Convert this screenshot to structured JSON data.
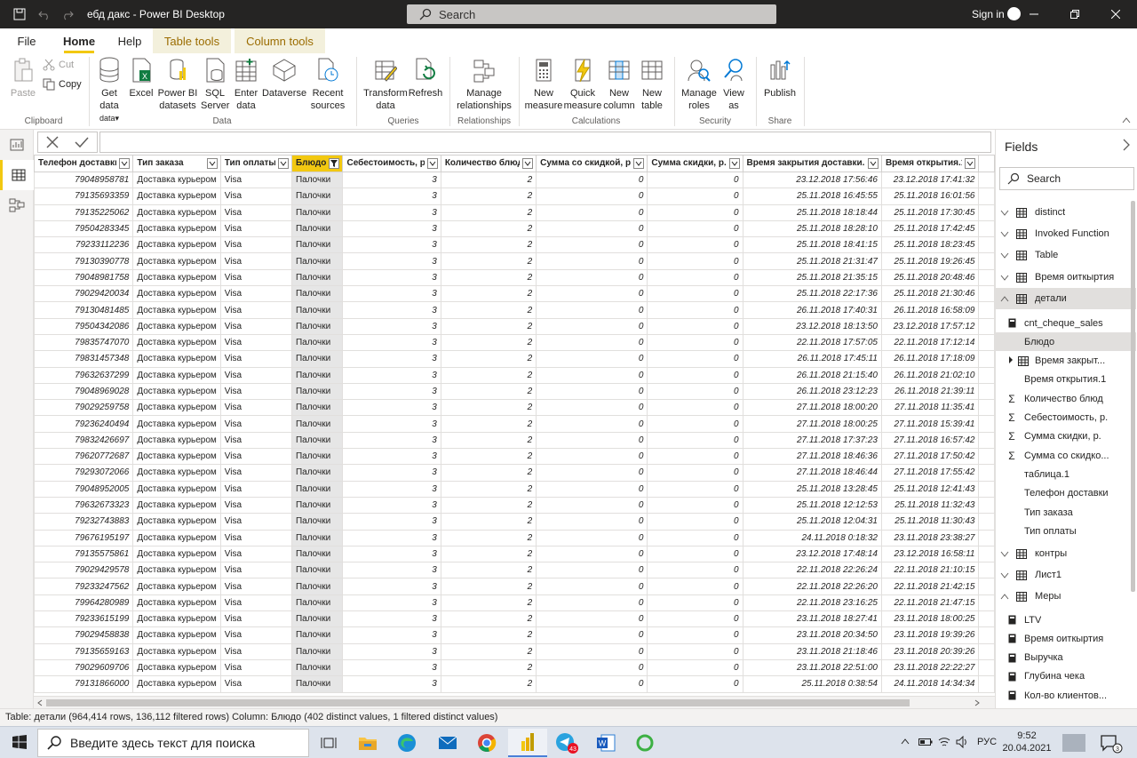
{
  "window": {
    "title": "ебд дакс - Power BI Desktop",
    "search_placeholder": "Search",
    "sign_in": "Sign in"
  },
  "ribbon_tabs": [
    "File",
    "Home",
    "Help",
    "Table tools",
    "Column tools"
  ],
  "ribbon": {
    "clipboard": {
      "paste": "Paste",
      "cut": "Cut",
      "copy": "Copy",
      "group": "Clipboard"
    },
    "data": {
      "get_data": "Get data",
      "excel": "Excel",
      "powerbi_datasets": "Power BI datasets",
      "sql_server": "SQL Server",
      "enter_data": "Enter data",
      "dataverse": "Dataverse",
      "recent_sources": "Recent sources",
      "group": "Data"
    },
    "queries": {
      "transform_data": "Transform data",
      "refresh": "Refresh",
      "group": "Queries"
    },
    "relationships": {
      "manage_relationships": "Manage relationships",
      "group": "Relationships"
    },
    "calculations": {
      "new_measure": "New measure",
      "quick_measure": "Quick measure",
      "new_column": "New column",
      "new_table": "New table",
      "group": "Calculations"
    },
    "security": {
      "manage_roles": "Manage roles",
      "view_as": "View as",
      "group": "Security"
    },
    "share": {
      "publish": "Publish",
      "group": "Share"
    }
  },
  "table": {
    "columns": [
      "Телефон доставки",
      "Тип заказа",
      "Тип оплаты",
      "Блюдо",
      "Себестоимость, р.",
      "Количество блюд",
      "Сумма со скидкой, р.",
      "Сумма скидки, р.",
      "Время закрытия доставки.1",
      "Время открытия.1",
      "та"
    ],
    "rows": [
      [
        "79048958781",
        "Доставка курьером",
        "Visa",
        "Палочки",
        "3",
        "2",
        "0",
        "0",
        "23.12.2018 17:56:46",
        "23.12.2018 17:41:32"
      ],
      [
        "79135693359",
        "Доставка курьером",
        "Visa",
        "Палочки",
        "3",
        "2",
        "0",
        "0",
        "25.11.2018 16:45:55",
        "25.11.2018 16:01:56"
      ],
      [
        "79135225062",
        "Доставка курьером",
        "Visa",
        "Палочки",
        "3",
        "2",
        "0",
        "0",
        "25.11.2018 18:18:44",
        "25.11.2018 17:30:45"
      ],
      [
        "79504283345",
        "Доставка курьером",
        "Visa",
        "Палочки",
        "3",
        "2",
        "0",
        "0",
        "25.11.2018 18:28:10",
        "25.11.2018 17:42:45"
      ],
      [
        "79233112236",
        "Доставка курьером",
        "Visa",
        "Палочки",
        "3",
        "2",
        "0",
        "0",
        "25.11.2018 18:41:15",
        "25.11.2018 18:23:45"
      ],
      [
        "79130390778",
        "Доставка курьером",
        "Visa",
        "Палочки",
        "3",
        "2",
        "0",
        "0",
        "25.11.2018 21:31:47",
        "25.11.2018 19:26:45"
      ],
      [
        "79048981758",
        "Доставка курьером",
        "Visa",
        "Палочки",
        "3",
        "2",
        "0",
        "0",
        "25.11.2018 21:35:15",
        "25.11.2018 20:48:46"
      ],
      [
        "79029420034",
        "Доставка курьером",
        "Visa",
        "Палочки",
        "3",
        "2",
        "0",
        "0",
        "25.11.2018 22:17:36",
        "25.11.2018 21:30:46"
      ],
      [
        "79130481485",
        "Доставка курьером",
        "Visa",
        "Палочки",
        "3",
        "2",
        "0",
        "0",
        "26.11.2018 17:40:31",
        "26.11.2018 16:58:09"
      ],
      [
        "79504342086",
        "Доставка курьером",
        "Visa",
        "Палочки",
        "3",
        "2",
        "0",
        "0",
        "23.12.2018 18:13:50",
        "23.12.2018 17:57:12"
      ],
      [
        "79835747070",
        "Доставка курьером",
        "Visa",
        "Палочки",
        "3",
        "2",
        "0",
        "0",
        "22.11.2018 17:57:05",
        "22.11.2018 17:12:14"
      ],
      [
        "79831457348",
        "Доставка курьером",
        "Visa",
        "Палочки",
        "3",
        "2",
        "0",
        "0",
        "26.11.2018 17:45:11",
        "26.11.2018 17:18:09"
      ],
      [
        "79632637299",
        "Доставка курьером",
        "Visa",
        "Палочки",
        "3",
        "2",
        "0",
        "0",
        "26.11.2018 21:15:40",
        "26.11.2018 21:02:10"
      ],
      [
        "79048969028",
        "Доставка курьером",
        "Visa",
        "Палочки",
        "3",
        "2",
        "0",
        "0",
        "26.11.2018 23:12:23",
        "26.11.2018 21:39:11"
      ],
      [
        "79029259758",
        "Доставка курьером",
        "Visa",
        "Палочки",
        "3",
        "2",
        "0",
        "0",
        "27.11.2018 18:00:20",
        "27.11.2018 11:35:41"
      ],
      [
        "79236240494",
        "Доставка курьером",
        "Visa",
        "Палочки",
        "3",
        "2",
        "0",
        "0",
        "27.11.2018 18:00:25",
        "27.11.2018 15:39:41"
      ],
      [
        "79832426697",
        "Доставка курьером",
        "Visa",
        "Палочки",
        "3",
        "2",
        "0",
        "0",
        "27.11.2018 17:37:23",
        "27.11.2018 16:57:42"
      ],
      [
        "79620772687",
        "Доставка курьером",
        "Visa",
        "Палочки",
        "3",
        "2",
        "0",
        "0",
        "27.11.2018 18:46:36",
        "27.11.2018 17:50:42"
      ],
      [
        "79293072066",
        "Доставка курьером",
        "Visa",
        "Палочки",
        "3",
        "2",
        "0",
        "0",
        "27.11.2018 18:46:44",
        "27.11.2018 17:55:42"
      ],
      [
        "79048952005",
        "Доставка курьером",
        "Visa",
        "Палочки",
        "3",
        "2",
        "0",
        "0",
        "25.11.2018 13:28:45",
        "25.11.2018 12:41:43"
      ],
      [
        "79632673323",
        "Доставка курьером",
        "Visa",
        "Палочки",
        "3",
        "2",
        "0",
        "0",
        "25.11.2018 12:12:53",
        "25.11.2018 11:32:43"
      ],
      [
        "79232743883",
        "Доставка курьером",
        "Visa",
        "Палочки",
        "3",
        "2",
        "0",
        "0",
        "25.11.2018 12:04:31",
        "25.11.2018 11:30:43"
      ],
      [
        "79676195197",
        "Доставка курьером",
        "Visa",
        "Палочки",
        "3",
        "2",
        "0",
        "0",
        "24.11.2018 0:18:32",
        "23.11.2018 23:38:27"
      ],
      [
        "79135575861",
        "Доставка курьером",
        "Visa",
        "Палочки",
        "3",
        "2",
        "0",
        "0",
        "23.12.2018 17:48:14",
        "23.12.2018 16:58:11"
      ],
      [
        "79029429578",
        "Доставка курьером",
        "Visa",
        "Палочки",
        "3",
        "2",
        "0",
        "0",
        "22.11.2018 22:26:24",
        "22.11.2018 21:10:15"
      ],
      [
        "79233247562",
        "Доставка курьером",
        "Visa",
        "Палочки",
        "3",
        "2",
        "0",
        "0",
        "22.11.2018 22:26:20",
        "22.11.2018 21:42:15"
      ],
      [
        "79964280989",
        "Доставка курьером",
        "Visa",
        "Палочки",
        "3",
        "2",
        "0",
        "0",
        "22.11.2018 23:16:25",
        "22.11.2018 21:47:15"
      ],
      [
        "79233615199",
        "Доставка курьером",
        "Visa",
        "Палочки",
        "3",
        "2",
        "0",
        "0",
        "23.11.2018 18:27:41",
        "23.11.2018 18:00:25"
      ],
      [
        "79029458838",
        "Доставка курьером",
        "Visa",
        "Палочки",
        "3",
        "2",
        "0",
        "0",
        "23.11.2018 20:34:50",
        "23.11.2018 19:39:26"
      ],
      [
        "79135659163",
        "Доставка курьером",
        "Visa",
        "Палочки",
        "3",
        "2",
        "0",
        "0",
        "23.11.2018 21:18:46",
        "23.11.2018 20:39:26"
      ],
      [
        "79029609706",
        "Доставка курьером",
        "Visa",
        "Палочки",
        "3",
        "2",
        "0",
        "0",
        "23.11.2018 22:51:00",
        "23.11.2018 22:22:27"
      ],
      [
        "79131866000",
        "Доставка курьером",
        "Visa",
        "Палочки",
        "3",
        "2",
        "0",
        "0",
        "25.11.2018 0:38:54",
        "24.11.2018 14:34:34"
      ]
    ]
  },
  "status": "Table: детали (964,414 rows, 136,112 filtered rows) Column: Блюдо (402 distinct values, 1 filtered distinct values)",
  "fields": {
    "title": "Fields",
    "search_placeholder": "Search",
    "tables_top": [
      "distinct",
      "Invoked Function",
      "Table",
      "Время оиткыртия",
      "детали"
    ],
    "detail_items": [
      "cnt_cheque_sales",
      "Блюдо",
      "Время закрыт...",
      "Время открытия.1",
      "Количество блюд",
      "Себестоимость, р.",
      "Сумма скидки, р.",
      "Сумма со скидко...",
      "таблица.1",
      "Телефон доставки",
      "Тип заказа",
      "Тип оплаты"
    ],
    "tables_bottom": [
      "контры",
      "Лист1",
      "Меры"
    ],
    "measure_items": [
      "LTV",
      "Время оиткыртия",
      "Выручка",
      "Глубина чека",
      "Кол-во клиентов..."
    ]
  },
  "taskbar": {
    "search_placeholder": "Введите здесь текст для поиска",
    "lang": "РУС",
    "time": "9:52",
    "date": "20.04.2021",
    "telegram_badge": "43",
    "notifications_badge": "3"
  },
  "colors": {
    "accent": "#f2c811",
    "titlebar": "#252423"
  }
}
